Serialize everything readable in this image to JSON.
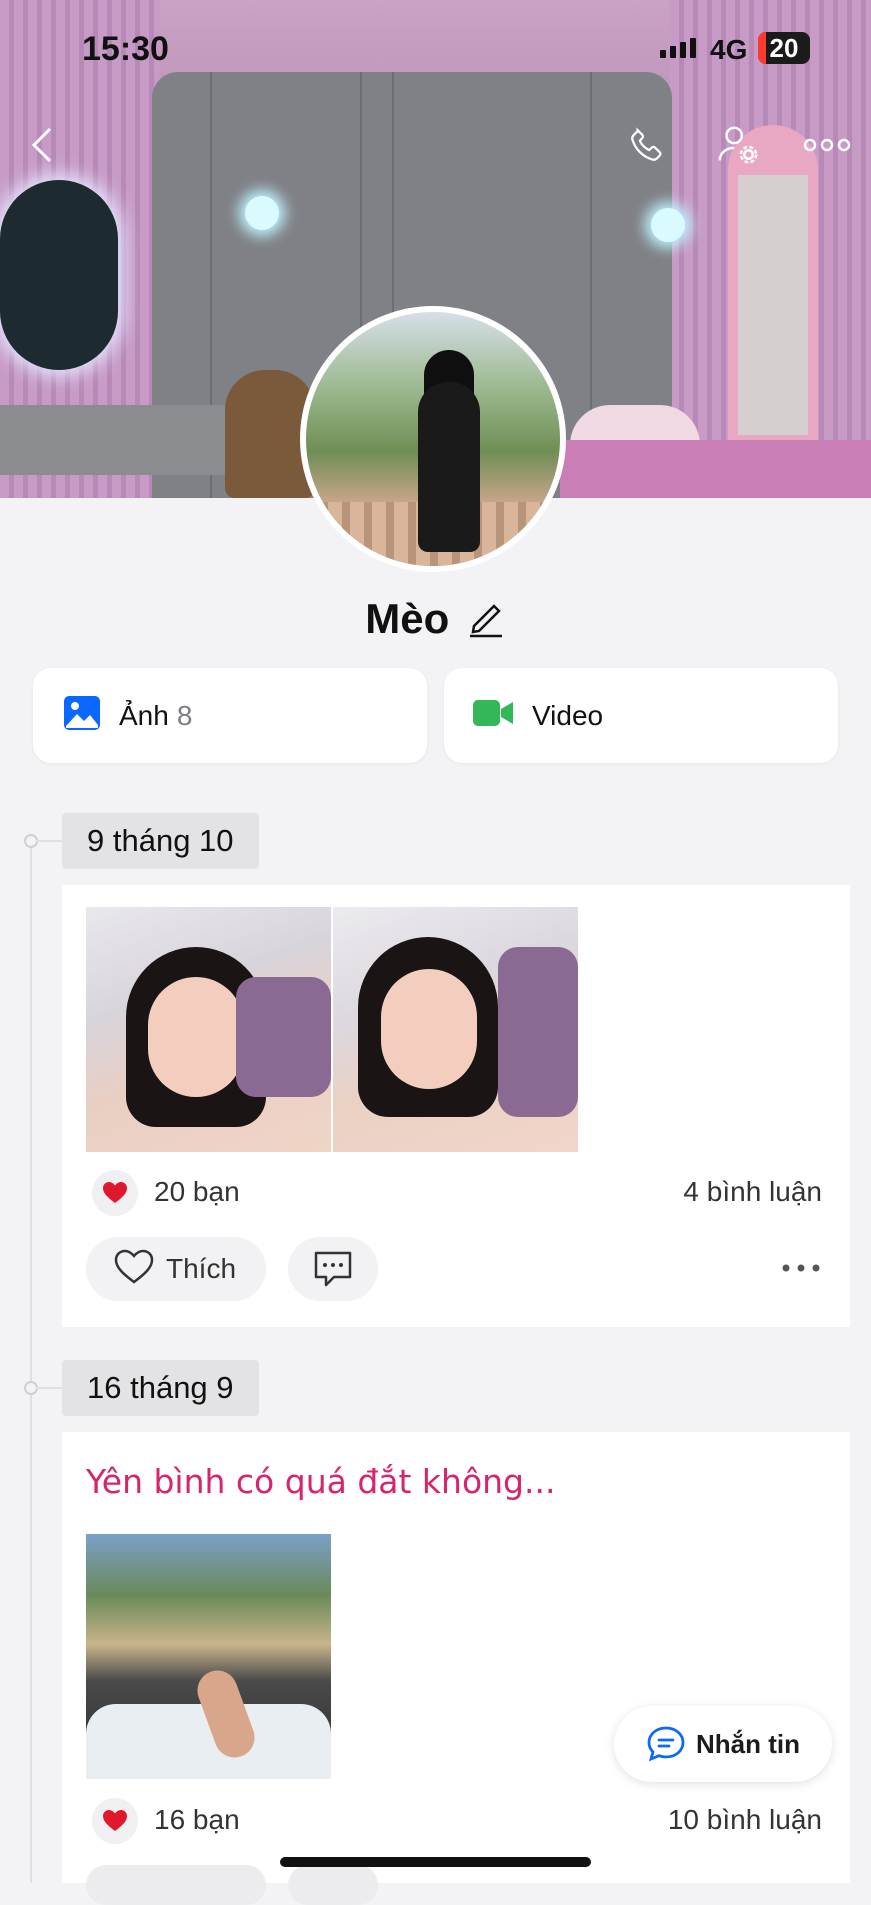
{
  "status_bar": {
    "time": "15:30",
    "network": "4G",
    "battery": "20"
  },
  "profile": {
    "name": "Mèo"
  },
  "media_cards": [
    {
      "label": "Ảnh",
      "count": "8"
    },
    {
      "label": "Video",
      "count": ""
    }
  ],
  "posts": [
    {
      "date": "9 tháng 10",
      "caption": "",
      "likes": "20 bạn",
      "comments": "4 bình luận",
      "like_label": "Thích"
    },
    {
      "date": "16 tháng 9",
      "caption": "Yên bình có quá đắt không...",
      "likes": "16 bạn",
      "comments": "10 bình luận"
    }
  ],
  "chat_button": {
    "label": "Nhắn tin"
  },
  "colors": {
    "accent": "#0a68ff",
    "video_green": "#34b759",
    "caption_pink": "#d6246e",
    "heart_red": "#e0182d"
  }
}
